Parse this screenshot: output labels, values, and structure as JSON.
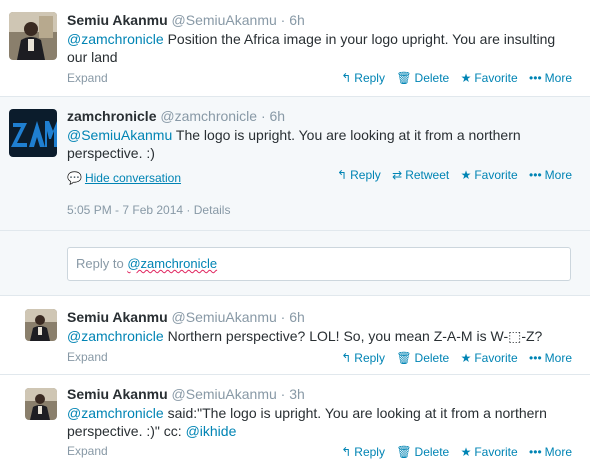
{
  "tweets": [
    {
      "name": "Semiu Akanmu",
      "handle": "@SemiuAkanmu",
      "time": "6h",
      "mention": "@zamchronicle",
      "text": " Position the Africa image in your logo upright. You are insulting our land",
      "expand": "Expand",
      "actions": {
        "reply": "Reply",
        "delete": "Delete",
        "favorite": "Favorite",
        "more": "More"
      }
    },
    {
      "name": "zamchronicle",
      "handle": "@zamchronicle",
      "time": "6h",
      "mention": "@SemiuAkanmu",
      "text": " The logo is upright. You are looking at it from a northern perspective. :)",
      "hide": "Hide conversation",
      "actions": {
        "reply": "Reply",
        "retweet": "Retweet",
        "favorite": "Favorite",
        "more": "More"
      },
      "timestamp": "5:05 PM - 7 Feb 2014",
      "details": "Details",
      "logo_text": "ZAM"
    },
    {
      "name": "Semiu Akanmu",
      "handle": "@SemiuAkanmu",
      "time": "6h",
      "mention": "@zamchronicle",
      "text": " Northern perspective? LOL! So, you mean Z-A-M is W-⬚-Z?",
      "expand": "Expand",
      "actions": {
        "reply": "Reply",
        "delete": "Delete",
        "favorite": "Favorite",
        "more": "More"
      }
    },
    {
      "name": "Semiu Akanmu",
      "handle": "@SemiuAkanmu",
      "time": "3h",
      "mention": "@zamchronicle",
      "text": " said:\"The logo is upright. You are looking at it from a northern perspective. :)\" cc: ",
      "mention2": "@ikhide",
      "expand": "Expand",
      "actions": {
        "reply": "Reply",
        "delete": "Delete",
        "favorite": "Favorite",
        "more": "More"
      }
    }
  ],
  "reply_box": {
    "prefix": "Reply to ",
    "handle": "@zamchronicle"
  },
  "dot": "·",
  "colors": {
    "link": "#0084b4",
    "muted": "#8899a6",
    "panel": "#f5f8fa",
    "logo_bg": "#0b1c2c",
    "logo_fg": "#1f7fd1"
  }
}
